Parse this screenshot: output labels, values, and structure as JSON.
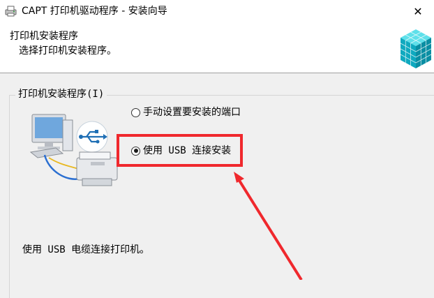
{
  "window": {
    "title": "CAPT 打印机驱动程序 - 安装向导",
    "close_label": "✕"
  },
  "header": {
    "title": "打印机安装程序",
    "subtitle": "选择打印机安装程序。"
  },
  "group": {
    "label": "打印机安装程序(I)",
    "options": [
      {
        "label": "手动设置要安装的端口",
        "selected": false
      },
      {
        "label": "使用 USB 连接安装",
        "selected": true
      }
    ],
    "description": "使用 USB 电缆连接打印机。"
  },
  "icons": {
    "app": "printer-driver-icon",
    "logo": "blue-cubes-logo-icon",
    "illustration": "computer-usb-printer-illustration",
    "close": "close-icon"
  },
  "colors": {
    "highlight": "#f0282d",
    "logo_teal": "#12b7c9",
    "usb_blue": "#1f6fb5"
  }
}
